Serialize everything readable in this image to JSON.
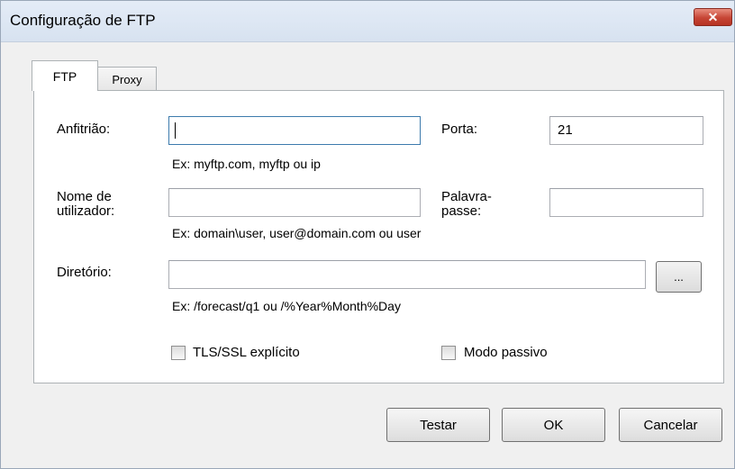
{
  "window": {
    "title": "Configuração de FTP",
    "close_glyph": "✕"
  },
  "tabs": [
    {
      "label": "FTP"
    },
    {
      "label": "Proxy"
    }
  ],
  "form": {
    "host": {
      "label": "Anfitrião:",
      "value": "",
      "hint": "Ex: myftp.com, myftp ou ip"
    },
    "port": {
      "label": "Porta:",
      "value": "21"
    },
    "user": {
      "label_line1": "Nome de",
      "label_line2": "utilizador:",
      "value": "",
      "hint": "Ex: domain\\user, user@domain.com ou user"
    },
    "password": {
      "label_line1": "Palavra-",
      "label_line2": "passe:",
      "value": ""
    },
    "directory": {
      "label": "Diretório:",
      "value": "",
      "hint": "Ex: /forecast/q1 ou  /%Year%Month%Day",
      "browse_label": "..."
    },
    "tls": {
      "label": "TLS/SSL explícito",
      "checked": false
    },
    "passive": {
      "label": "Modo passivo",
      "checked": false
    }
  },
  "buttons": {
    "test": "Testar",
    "ok": "OK",
    "cancel": "Cancelar"
  },
  "icons": {
    "close": "close-icon"
  }
}
